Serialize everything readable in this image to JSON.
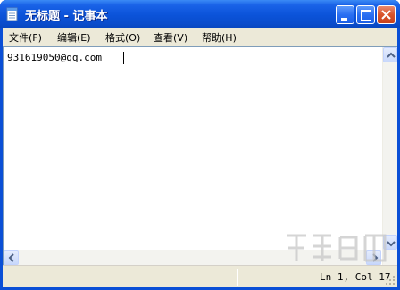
{
  "window": {
    "title": "无标题 - 记事本",
    "app_icon": "notepad-icon",
    "controls": [
      "minimize-icon",
      "maximize-icon",
      "close-icon"
    ]
  },
  "menu": {
    "items": [
      {
        "label": "文件(F)"
      },
      {
        "label": "编辑(E)"
      },
      {
        "label": "格式(O)"
      },
      {
        "label": "查看(V)"
      },
      {
        "label": "帮助(H)"
      }
    ]
  },
  "editor": {
    "content": "931619050@qq.com"
  },
  "statusbar": {
    "position": "Ln 1, Col 17"
  },
  "colors": {
    "titlebar_blue": "#0b53d9",
    "menubar_bg": "#ece9d8",
    "close_red": "#d9542c"
  }
}
